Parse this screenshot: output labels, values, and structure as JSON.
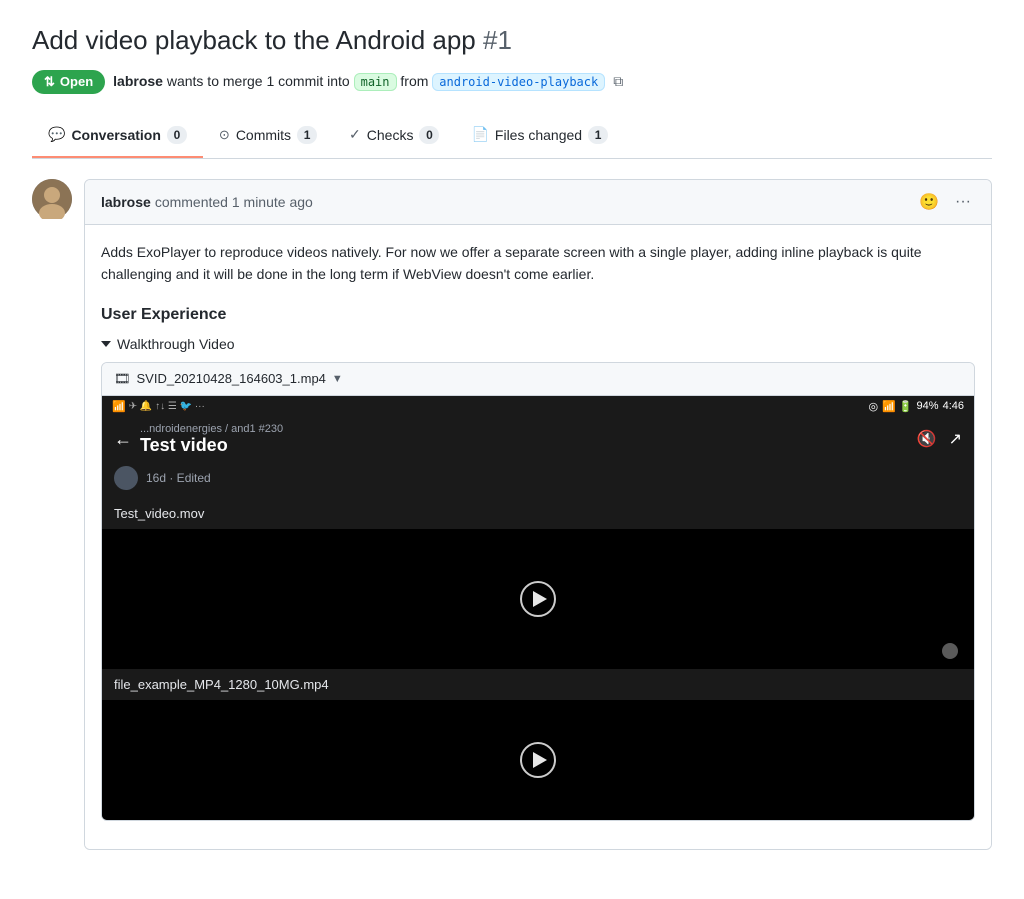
{
  "page": {
    "title": "Add video playback to the Android app",
    "pr_number": "#1",
    "open_badge": "Open",
    "meta_text": "wants to merge 1 commit into",
    "username": "labrose",
    "branch_main": "main",
    "branch_feature": "android-video-playback"
  },
  "tabs": [
    {
      "label": "Conversation",
      "count": "0",
      "active": true,
      "icon": "💬"
    },
    {
      "label": "Commits",
      "count": "1",
      "active": false,
      "icon": "⊙"
    },
    {
      "label": "Checks",
      "count": "0",
      "active": false,
      "icon": "✓"
    },
    {
      "label": "Files changed",
      "count": "1",
      "active": false,
      "icon": "📄"
    }
  ],
  "comment": {
    "author": "labrose",
    "action": "commented",
    "time": "1 minute ago",
    "body": "Adds ExoPlayer to reproduce videos natively. For now we offer a separate screen with a single player, adding inline playback is quite challenging and it will be done in the long term if WebView doesn't come earlier.",
    "subheading": "User Experience",
    "walkthrough_label": "Walkthrough Video",
    "attachment_filename": "SVID_20210428_164603_1.mp4"
  },
  "phone_screen": {
    "status_bar": {
      "left": "... ndroidenergies / and1 #230",
      "time": "4:46",
      "battery": "94%"
    },
    "nav": {
      "path": "...ndroidenergies / and1 #230",
      "title": "Test video"
    },
    "subtitle": "16d · Edited",
    "first_file": "Test_video.mov",
    "second_file": "file_example_MP4_1280_10MG.mp4"
  },
  "icons": {
    "open_icon": "⇅",
    "copy_icon": "⧉",
    "emoji_icon": "🙂",
    "more_icon": "•••",
    "film_icon": "🎞",
    "mute_icon": "🔇",
    "share_icon": "↗",
    "back_icon": "←"
  }
}
